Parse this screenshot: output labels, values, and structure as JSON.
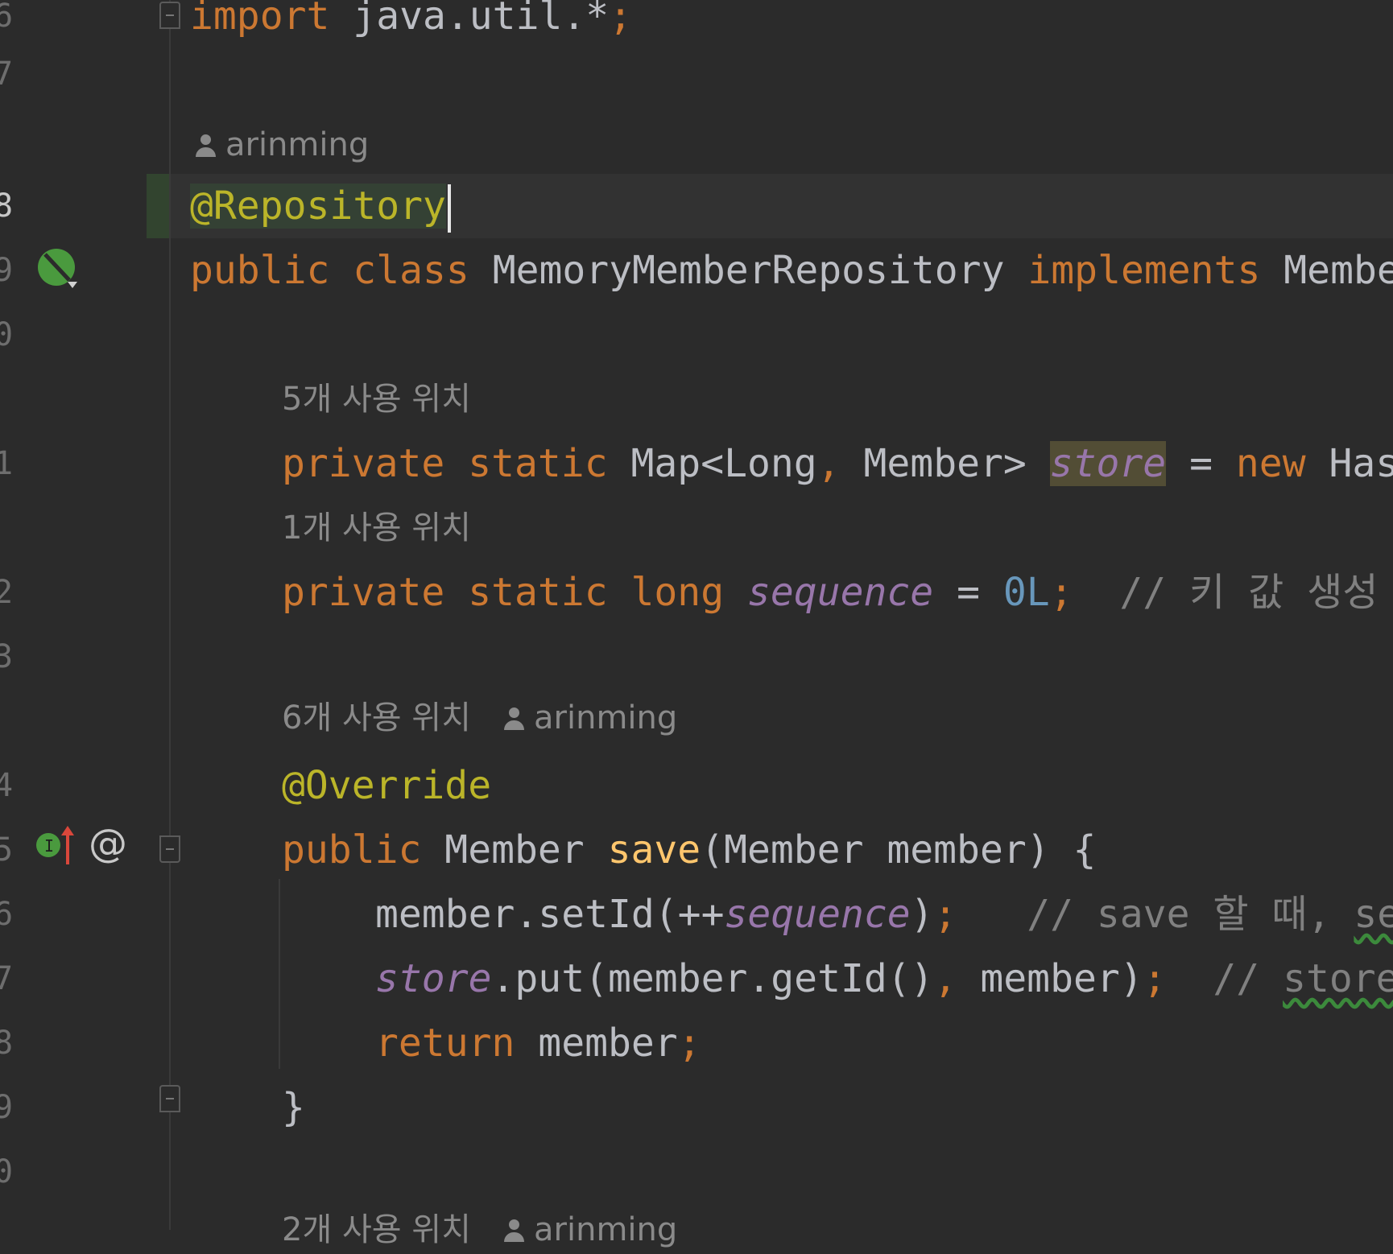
{
  "gutter": {
    "line_numbers": [
      "6",
      "7",
      "8",
      "9",
      "0",
      "1",
      "2",
      "3",
      "4",
      "5",
      "6",
      "7",
      "8",
      "9",
      "0"
    ]
  },
  "hints": {
    "author1": "arinming",
    "usages_store": "5개 사용 위치",
    "usages_sequence": "1개 사용 위치",
    "usages_save": "6개 사용 위치",
    "author2": "arinming",
    "usages_next": "2개 사용 위치",
    "author3": "arinming"
  },
  "code": {
    "l6_kw": "import",
    "l6_rest": " java.util.*",
    "l6_semi": ";",
    "l8_ann": "@Repository",
    "l9_kw1": "public",
    "l9_kw2": "class",
    "l9_name": "MemoryMemberRepository",
    "l9_kw3": "implements",
    "l9_iface": "Membe",
    "l11_kw1": "private",
    "l11_kw2": "static",
    "l11_type": "Map<Long",
    "l11_comma": ",",
    "l11_type2": " Member>",
    "l11_field": "store",
    "l11_eq": " = ",
    "l11_kw3": "new",
    "l11_rest": " Has",
    "l12_kw1": "private",
    "l12_kw2": "static",
    "l12_kw3": "long",
    "l12_field": "sequence",
    "l12_eq": " = ",
    "l12_num": "0L",
    "l12_semi": ";",
    "l12_cmt": "// 키 값 생성",
    "l14_ann": "@Override",
    "l15_kw": "public",
    "l15_type": " Member ",
    "l15_fn": "save",
    "l15_rest": "(Member member) {",
    "l16_a": "member.setId(++",
    "l16_field": "sequence",
    "l16_b": ")",
    "l16_semi": ";",
    "l16_cmt": "// save 할 때, ",
    "l16_cmt2": "se",
    "l17_field": "store",
    "l17_a": ".put(member.getId()",
    "l17_comma": ",",
    "l17_b": " member)",
    "l17_semi": ";",
    "l17_cmt": "// ",
    "l17_cmt2": "store",
    "l18_kw": "return",
    "l18_a": " member",
    "l18_semi": ";",
    "l19_brace": "}"
  },
  "icons": {
    "bean": "spring-bean-icon",
    "implements": "implements-method-icon",
    "at": "@"
  },
  "colors": {
    "background": "#2b2b2b",
    "keyword": "#cc7832",
    "annotation": "#bbb529",
    "field": "#9876aa",
    "number": "#6897bb",
    "comment": "#808080",
    "method": "#ffc66d"
  }
}
